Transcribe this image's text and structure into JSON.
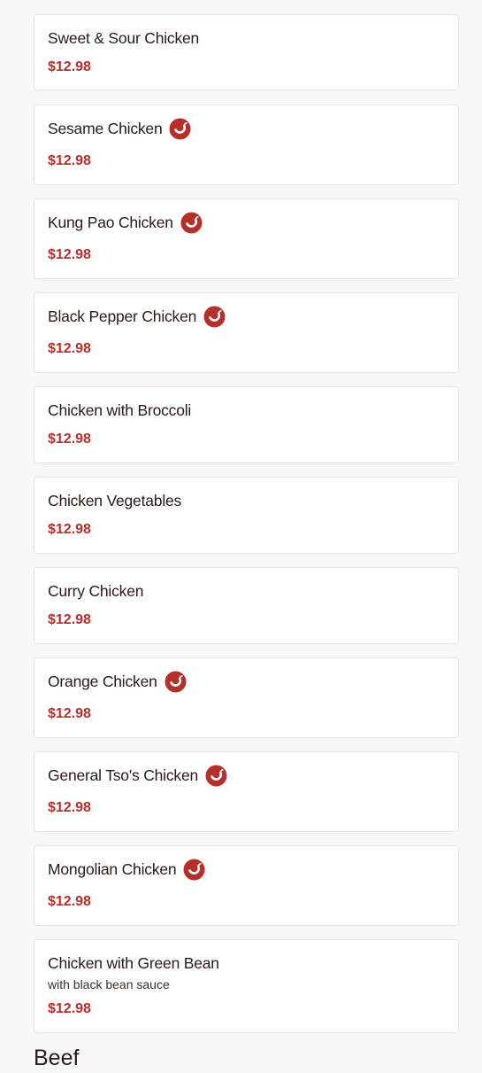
{
  "colors": {
    "price": "#b5302b",
    "spicy_badge": "#b5302b",
    "card_background": "#ffffff",
    "page_background": "#f7f7f7"
  },
  "items": [
    {
      "name": "Sweet & Sour Chicken",
      "price": "$12.98",
      "spicy": false
    },
    {
      "name": "Sesame Chicken",
      "price": "$12.98",
      "spicy": true
    },
    {
      "name": "Kung Pao Chicken",
      "price": "$12.98",
      "spicy": true
    },
    {
      "name": "Black Pepper Chicken",
      "price": "$12.98",
      "spicy": true
    },
    {
      "name": "Chicken with Broccoli",
      "price": "$12.98",
      "spicy": false
    },
    {
      "name": "Chicken Vegetables",
      "price": "$12.98",
      "spicy": false
    },
    {
      "name": "Curry Chicken",
      "price": "$12.98",
      "spicy": false
    },
    {
      "name": "Orange Chicken",
      "price": "$12.98",
      "spicy": true
    },
    {
      "name": "General Tso's Chicken",
      "price": "$12.98",
      "spicy": true
    },
    {
      "name": "Mongolian Chicken",
      "price": "$12.98",
      "spicy": true
    },
    {
      "name": "Chicken with Green Bean",
      "description": "with black bean sauce",
      "price": "$12.98",
      "spicy": false
    }
  ],
  "next_section": {
    "title": "Beef"
  },
  "icons": {
    "spicy": "chili-pepper-icon"
  }
}
